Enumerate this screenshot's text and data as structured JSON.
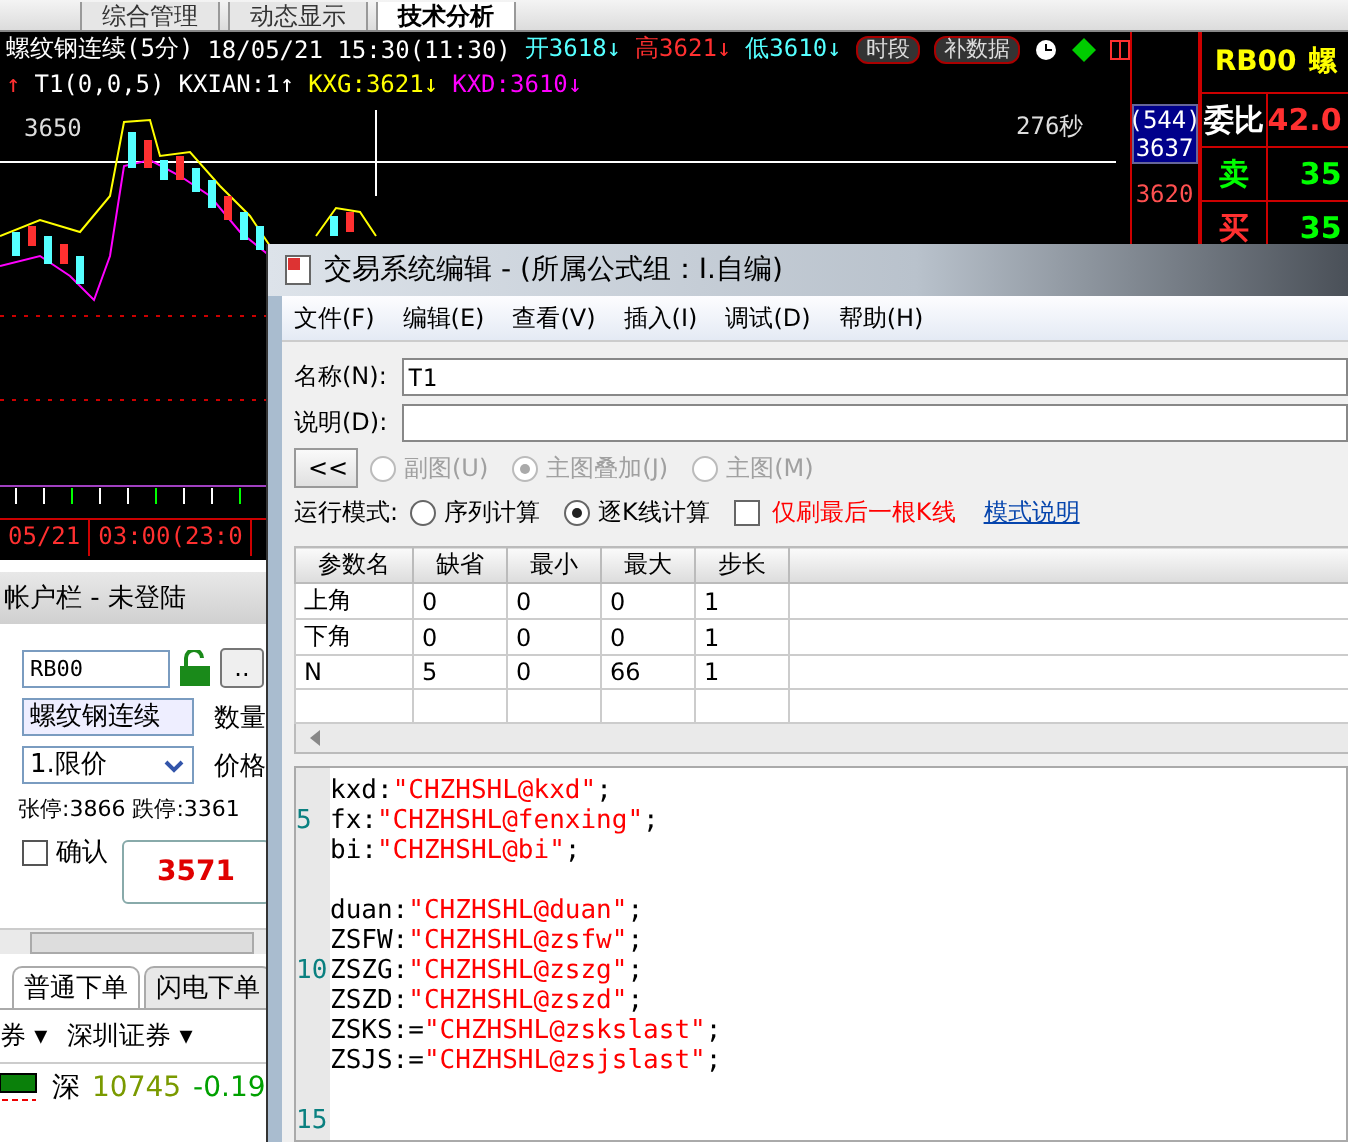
{
  "app_tabs": [
    {
      "label": "综合管理",
      "selected": false
    },
    {
      "label": "动态显示",
      "selected": false
    },
    {
      "label": "技术分析",
      "selected": true
    }
  ],
  "chart": {
    "title": "螺纹钢连续(5分)",
    "datetime": "18/05/21 15:30(11:30)",
    "quotes": [
      {
        "text": "开3618",
        "arrow": "↓",
        "color": "#55ffff"
      },
      {
        "text": "高3621",
        "arrow": "↓",
        "color": "#ff3030"
      },
      {
        "text": "低3610",
        "arrow": "↓",
        "color": "#55ffff"
      }
    ],
    "buttons": [
      "时段",
      "补数据"
    ],
    "indicator_marker": "↑",
    "indicators": [
      {
        "text": "T1(0,0,5)",
        "color": "#ffffff"
      },
      {
        "text": "KXIAN:1",
        "arrow": "↑",
        "color": "#ffffff"
      },
      {
        "text": "KXG:3621",
        "arrow": "↓",
        "color": "#ffff00"
      },
      {
        "text": "KXD:3610",
        "arrow": "↓",
        "color": "#ff00ff"
      }
    ],
    "price_label": "3650",
    "countdown": "276秒",
    "axis": {
      "volume": "(544)",
      "price": "3637",
      "lower": "3620"
    },
    "dates": [
      "05/21",
      "03:00(23:0"
    ]
  },
  "quote_panel": {
    "symbol": "RB00",
    "name": "螺",
    "ratio_label": "委比",
    "ratio": "42.0",
    "rows": [
      {
        "kind": "sell",
        "label": "卖",
        "value": "35"
      },
      {
        "kind": "buy",
        "label": "买",
        "value": "35"
      }
    ]
  },
  "account": {
    "title": "帐户栏 - 未登陆",
    "symbol": "RB00",
    "more_button": "..",
    "name": "螺纹钢连续",
    "quantity_label": "数量",
    "order_type": "1.限价",
    "price_label": "价格",
    "limits": "张停:3866 跌停:3361",
    "confirm": {
      "label": "确认",
      "checked": false
    },
    "price_button": "3571",
    "order_tabs": [
      {
        "label": "普通下单",
        "selected": true
      },
      {
        "label": "闪电下单",
        "selected": false
      }
    ],
    "markets": [
      {
        "label": "券",
        "caret": "▾"
      },
      {
        "label": "深圳证券",
        "caret": "▾"
      }
    ],
    "index": {
      "market": "深",
      "value": "10745",
      "change": "-0.19"
    }
  },
  "dialog": {
    "title": "交易系统编辑 - (所属公式组：I.自编)",
    "menu": [
      "文件(F)",
      "编辑(E)",
      "查看(V)",
      "插入(I)",
      "调试(D)",
      "帮助(H)"
    ],
    "name_label": "名称(N):",
    "name_value": "T1",
    "desc_label": "说明(D):",
    "collapse_button": "<<",
    "chart_options": [
      {
        "label": "副图(U)",
        "selected": false,
        "disabled": true
      },
      {
        "label": "主图叠加(J)",
        "selected": true,
        "disabled": true
      },
      {
        "label": "主图(M)",
        "selected": false,
        "disabled": true
      }
    ],
    "mode_label": "运行模式:",
    "modes": [
      {
        "label": "序列计算",
        "selected": false
      },
      {
        "label": "逐K线计算",
        "selected": true
      }
    ],
    "refresh_option": {
      "label": "仅刷最后一根K线",
      "checked": false
    },
    "help_link": "模式说明",
    "params": {
      "columns": [
        "参数名",
        "缺省",
        "最小",
        "最大",
        "步长"
      ],
      "rows": [
        [
          "上角",
          "0",
          "0",
          "0",
          "1"
        ],
        [
          "下角",
          "0",
          "0",
          "0",
          "1"
        ],
        [
          "N",
          "5",
          "0",
          "66",
          "1"
        ]
      ]
    },
    "code": [
      {
        "kind": "statement",
        "name": "kxd:",
        "value": "\"CHZHSHL@kxd\"",
        "end": ";"
      },
      {
        "kind": "statement",
        "line_number": "5",
        "name": "fx:",
        "value": "\"CHZHSHL@fenxing\"",
        "end": ";"
      },
      {
        "kind": "statement",
        "name": "bi:",
        "value": "\"CHZHSHL@bi\"",
        "end": ";"
      },
      {
        "kind": "blank"
      },
      {
        "kind": "statement",
        "name": "duan:",
        "value": "\"CHZHSHL@duan\"",
        "end": ";"
      },
      {
        "kind": "statement",
        "name": "ZSFW:",
        "value": "\"CHZHSHL@zsfw\"",
        "end": ";"
      },
      {
        "kind": "statement",
        "line_number": "10",
        "name": "ZSZG:",
        "value": "\"CHZHSHL@zszg\"",
        "end": ";"
      },
      {
        "kind": "statement",
        "name": "ZSZD:",
        "value": "\"CHZHSHL@zszd\"",
        "end": ";"
      },
      {
        "kind": "statement",
        "name": "ZSKS:=",
        "value": "\"CHZHSHL@zskslast\"",
        "end": ";"
      },
      {
        "kind": "statement",
        "name": "ZSJS:=",
        "value": "\"CHZHSHL@zsjslast\"",
        "end": ";"
      },
      {
        "kind": "blank"
      },
      {
        "kind": "blank",
        "line_number": "15"
      }
    ]
  }
}
